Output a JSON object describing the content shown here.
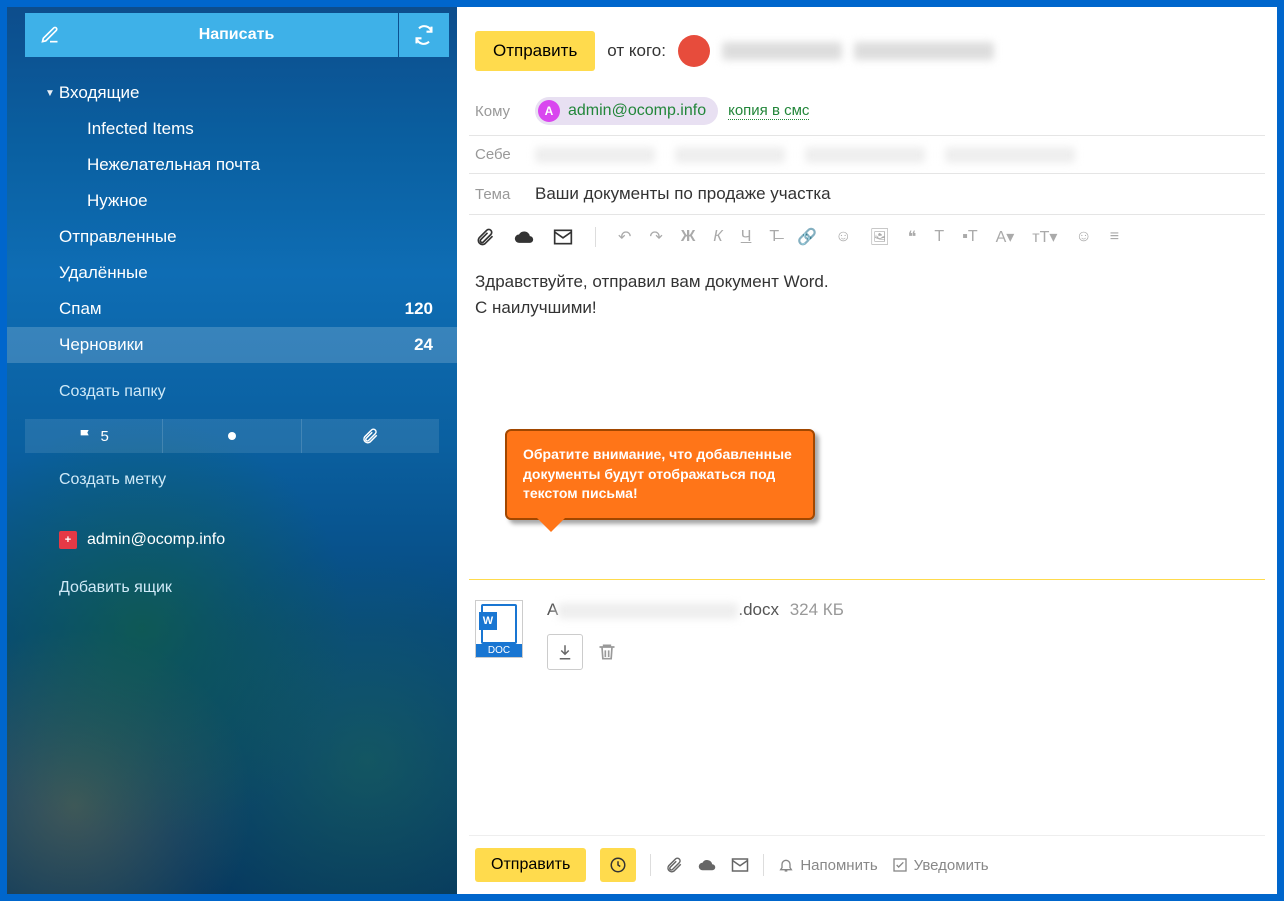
{
  "sidebar": {
    "compose_label": "Написать",
    "folders": [
      {
        "label": "Входящие",
        "count": "",
        "expanded": true,
        "sub": false
      },
      {
        "label": "Infected Items",
        "count": "",
        "sub": true
      },
      {
        "label": "Нежелательная почта",
        "count": "",
        "sub": true
      },
      {
        "label": "Нужное",
        "count": "",
        "sub": true
      },
      {
        "label": "Отправленные",
        "count": "",
        "sub": false
      },
      {
        "label": "Удалённые",
        "count": "",
        "sub": false
      },
      {
        "label": "Спам",
        "count": "120",
        "sub": false
      },
      {
        "label": "Черновики",
        "count": "24",
        "sub": false,
        "active": true
      }
    ],
    "create_folder": "Создать папку",
    "flag_count": "5",
    "create_label": "Создать метку",
    "mailbox": "admin@ocomp.info",
    "add_mailbox": "Добавить ящик"
  },
  "compose": {
    "send_label": "Отправить",
    "from_label": "от кого:",
    "to_label": "Кому",
    "to_chip_initial": "A",
    "to_chip_email": "admin@ocomp.info",
    "sms_link": "копия в смс",
    "self_label": "Себе",
    "subject_label": "Тема",
    "subject_value": "Ваши документы по продаже участка",
    "body_line1": "Здравствуйте, отправил вам документ Word.",
    "body_line2": "С наилучшими!",
    "callout_text": "Обратите внимание, что добавленные документы будут отображаться под текстом письма!",
    "attachment": {
      "name_prefix": "А",
      "name_suffix": ".docx",
      "size": "324 КБ",
      "doc_label": "DOC"
    },
    "footer": {
      "send": "Отправить",
      "remind": "Напомнить",
      "notify": "Уведомить"
    }
  }
}
